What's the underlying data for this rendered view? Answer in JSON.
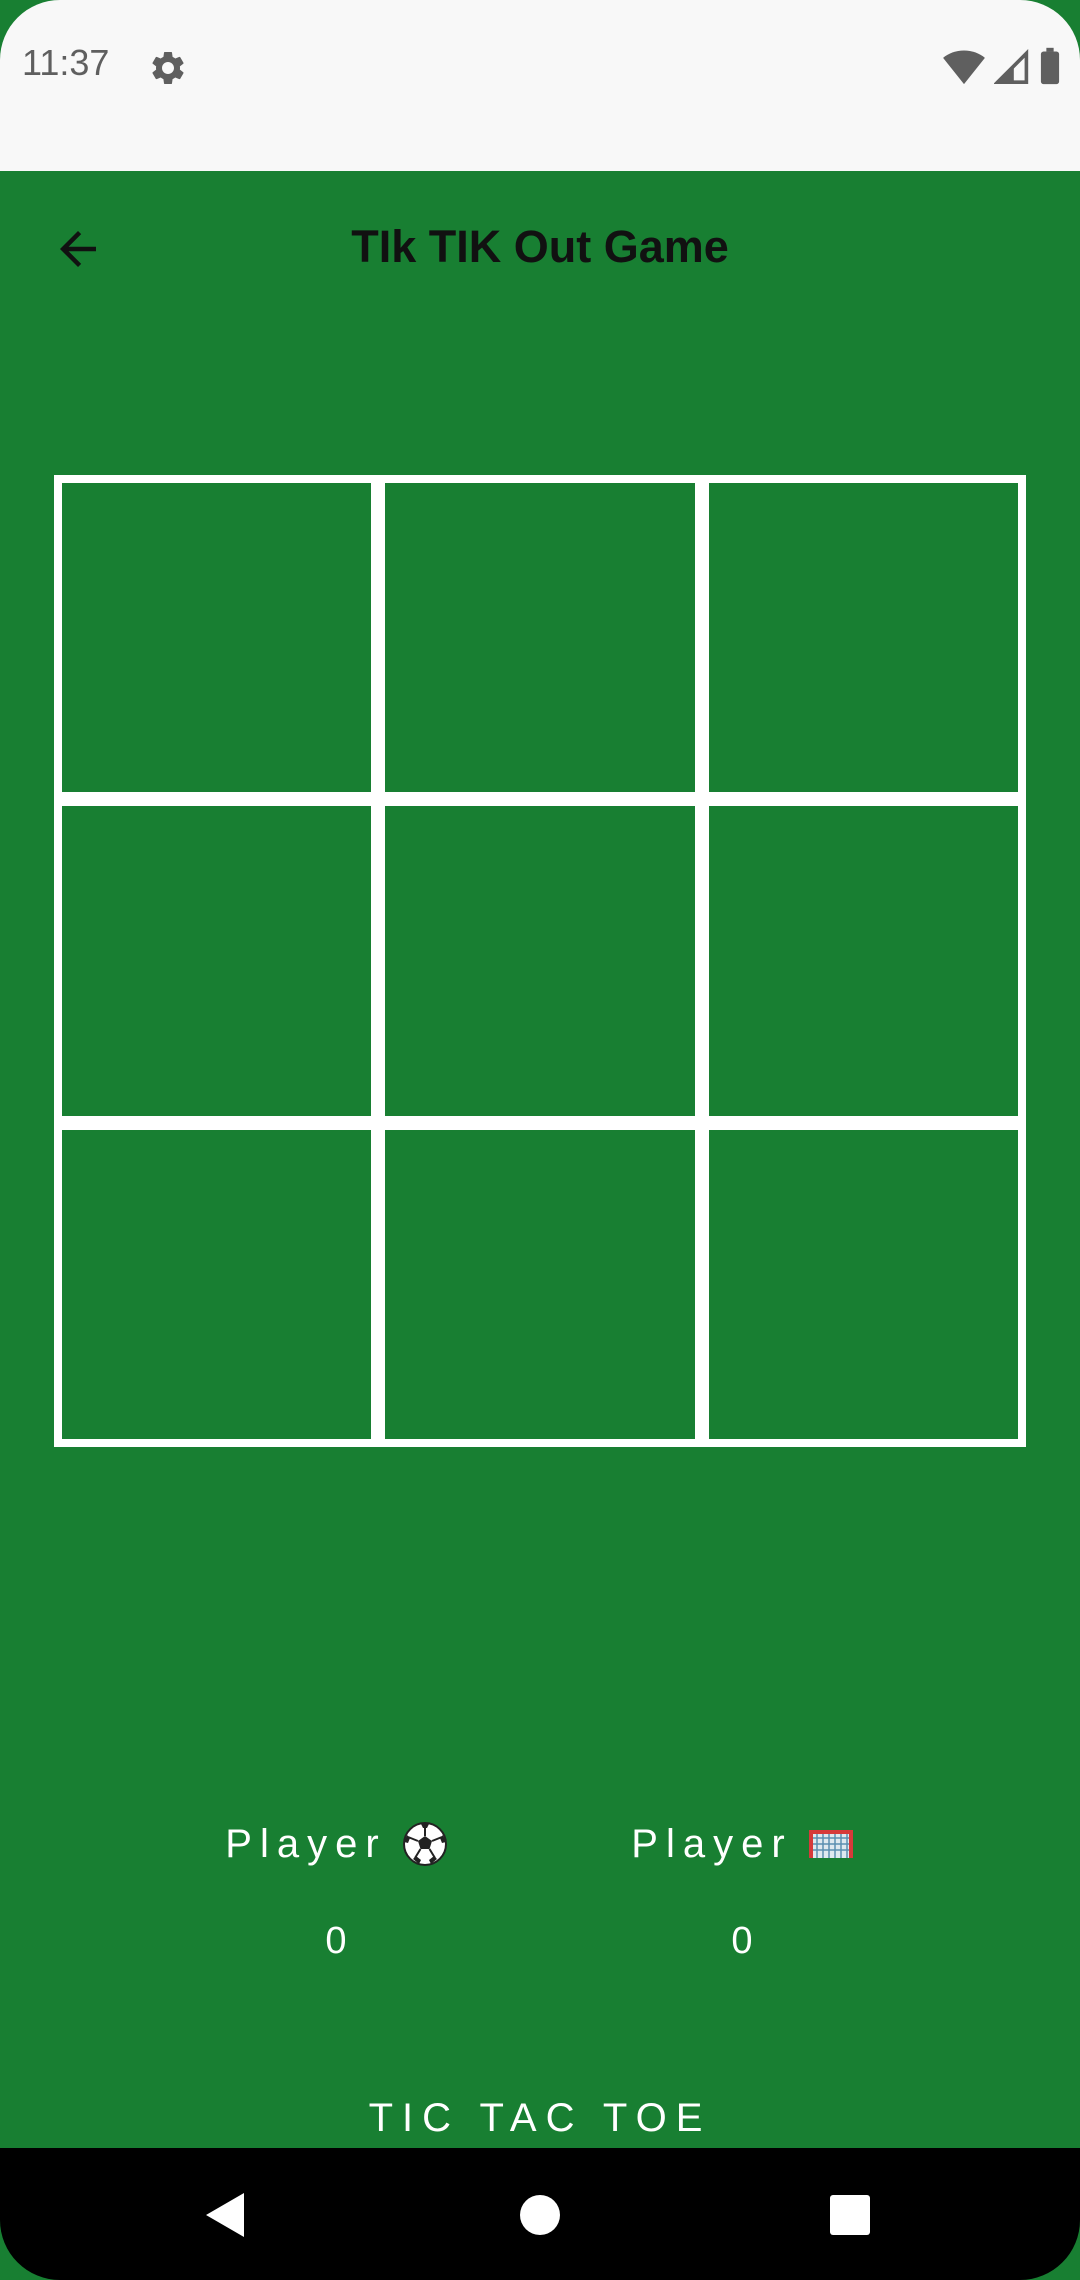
{
  "status_bar": {
    "time": "11:37",
    "icons": [
      "settings-icon",
      "wifi-icon",
      "signal-icon",
      "battery-icon"
    ]
  },
  "app_bar": {
    "title": "TIk TIK Out Game",
    "back_icon": "arrow-back-icon"
  },
  "board": {
    "cells": [
      "",
      "",
      "",
      "",
      "",
      "",
      "",
      "",
      ""
    ]
  },
  "players": [
    {
      "label": "Player",
      "icon": "soccer-ball-icon",
      "score": "0"
    },
    {
      "label": "Player",
      "icon": "goal-net-icon",
      "score": "0"
    }
  ],
  "footer": {
    "title": "TIC TAC TOE"
  },
  "nav_bar": {
    "icons": [
      "back-triangle-icon",
      "home-circle-icon",
      "recents-square-icon"
    ]
  },
  "colors": {
    "background": "#187f32",
    "grid_lines": "#ffffff",
    "status_bar": "#f8f8f8",
    "nav_bar": "#000000",
    "title_text": "#111111"
  }
}
